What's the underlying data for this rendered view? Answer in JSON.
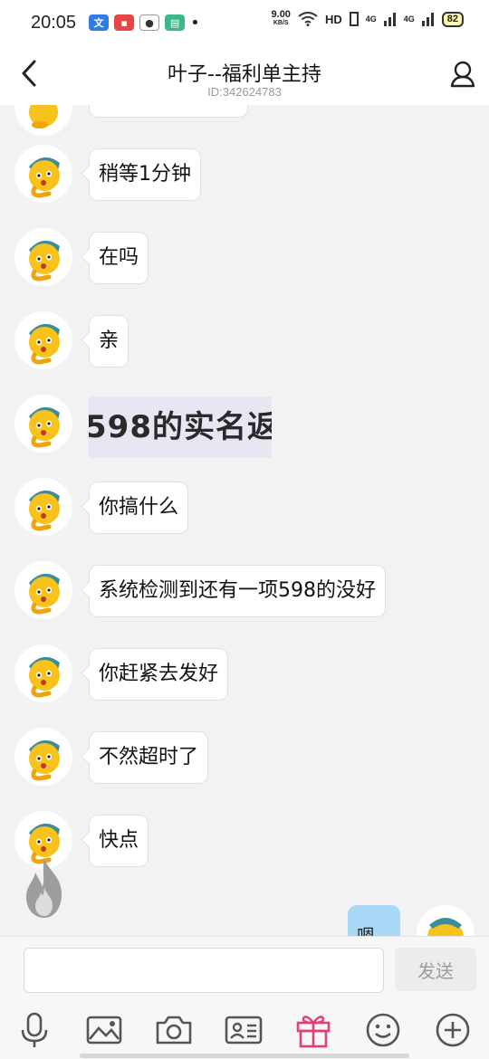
{
  "status_bar": {
    "time": "20:05",
    "net_speed": "9.00",
    "net_unit": "KB/S",
    "hd_label": "HD",
    "sig1": "4G",
    "sig2": "4G",
    "battery": "82",
    "dot": "•"
  },
  "header": {
    "title": "叶子--福利单主持",
    "subtitle": "ID:342624783"
  },
  "messages": [
    {
      "type": "text",
      "text": "稍等1分钟"
    },
    {
      "type": "text",
      "text": "在吗"
    },
    {
      "type": "text",
      "text": "亲"
    },
    {
      "type": "image",
      "text": "598的实名返"
    },
    {
      "type": "text",
      "text": "你搞什么"
    },
    {
      "type": "text",
      "text": "系统检测到还有一项598的没好"
    },
    {
      "type": "text",
      "text": "你赶紧去发好"
    },
    {
      "type": "text",
      "text": "不然超时了"
    },
    {
      "type": "text",
      "text": "快点"
    }
  ],
  "outgoing": {
    "text": "嗯"
  },
  "input": {
    "value": "",
    "send_label": "发送"
  },
  "toolbar": [
    {
      "icon": "microphone-icon"
    },
    {
      "icon": "image-icon"
    },
    {
      "icon": "camera-icon"
    },
    {
      "icon": "contact-card-icon"
    },
    {
      "icon": "gift-icon",
      "color": "#e23f7a"
    },
    {
      "icon": "emoji-icon"
    },
    {
      "icon": "plus-icon"
    }
  ],
  "colors": {
    "accent_gift": "#e23f7a",
    "outgoing_bubble": "#a8d8f6",
    "background": "#f2f2f4"
  }
}
